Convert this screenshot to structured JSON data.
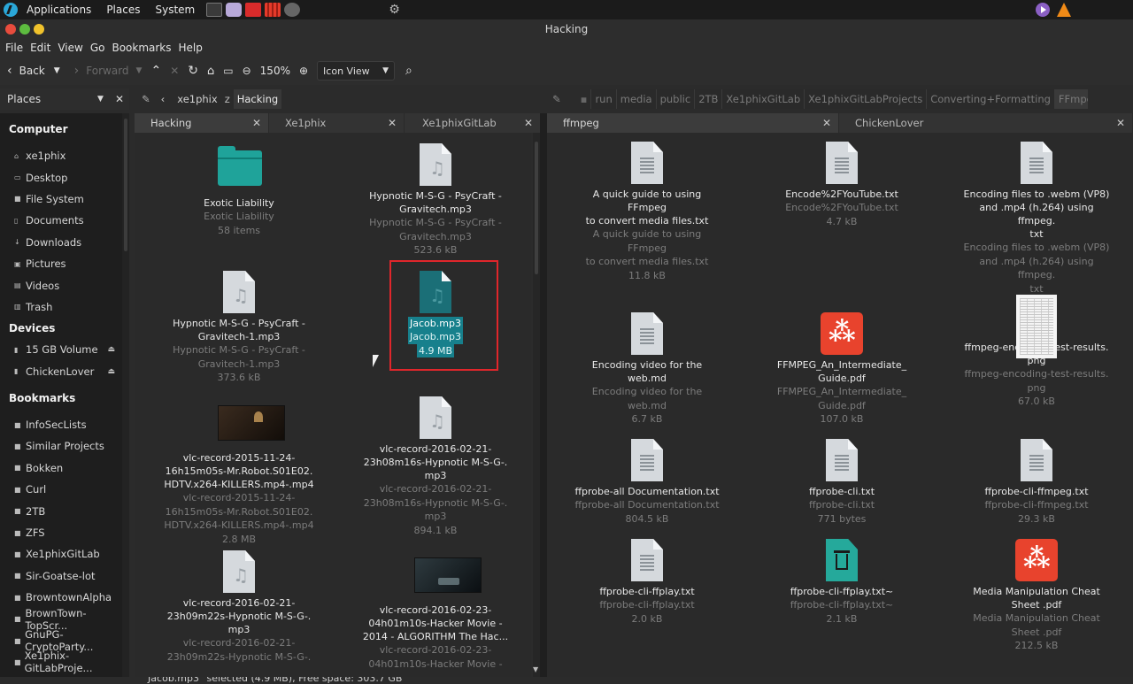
{
  "top_panel": {
    "menus": [
      "Applications",
      "Places",
      "System"
    ]
  },
  "window": {
    "title": "Hacking"
  },
  "menubar": [
    "File",
    "Edit",
    "View",
    "Go",
    "Bookmarks",
    "Help"
  ],
  "toolbar": {
    "back": "Back",
    "forward": "Forward",
    "zoom": "150%",
    "view_mode": "Icon View"
  },
  "sidebar": {
    "header": "Places",
    "sections": [
      {
        "title": "Computer",
        "items": [
          "xe1phix",
          "Desktop",
          "File System",
          "Documents",
          "Downloads",
          "Pictures",
          "Videos",
          "Trash"
        ]
      },
      {
        "title": "Devices",
        "items": [
          "15 GB Volume",
          "ChickenLover"
        ]
      },
      {
        "title": "Bookmarks",
        "items": [
          "InfoSecLists",
          "Similar Projects",
          "Bokken",
          "Curl",
          "2TB",
          "ZFS",
          "Xe1phixGitLab",
          "Sir-Goatse-lot",
          "BrowntownAlpha",
          "BrownTown-TopScr...",
          "GnuPG-CryptoParty...",
          "Xe1phix-GitLabProje..."
        ]
      }
    ]
  },
  "left_pane": {
    "path": [
      "xe1phix",
      "Hacking"
    ],
    "tabs": [
      "Hacking",
      "Xe1phix",
      "Xe1phixGitLab"
    ],
    "items": [
      {
        "name": [
          "Exotic Liability"
        ],
        "sub": [
          "Exotic Liability",
          "58 items"
        ],
        "icon": "folder"
      },
      {
        "name": [
          "Hypnotic M-S-G - PsyCraft -",
          "Gravitech.mp3"
        ],
        "sub": [
          "Hypnotic M-S-G - PsyCraft -",
          "Gravitech.mp3",
          "523.6 kB"
        ],
        "icon": "audio"
      },
      {
        "name": [
          "Hypnotic M-S-G - PsyCraft -",
          "Gravitech-1.mp3"
        ],
        "sub": [
          "Hypnotic M-S-G - PsyCraft -",
          "Gravitech-1.mp3",
          "373.6 kB"
        ],
        "icon": "audio"
      },
      {
        "name": [
          "Jacob.mp3"
        ],
        "sub": [
          "Jacob.mp3",
          "4.9 MB"
        ],
        "icon": "audio",
        "selected": true
      },
      {
        "name": [
          "vlc-record-2015-11-24-",
          "16h15m05s-Mr.Robot.S01E02.",
          "HDTV.x264-KILLERS.mp4-.mp4"
        ],
        "sub": [
          "vlc-record-2015-11-24-",
          "16h15m05s-Mr.Robot.S01E02.",
          "HDTV.x264-KILLERS.mp4-.mp4",
          "2.8 MB"
        ],
        "icon": "video-a"
      },
      {
        "name": [
          "vlc-record-2016-02-21-",
          "23h08m16s-Hypnotic M-S-G-.",
          "mp3"
        ],
        "sub": [
          "vlc-record-2016-02-21-",
          "23h08m16s-Hypnotic M-S-G-.",
          "mp3",
          "894.1 kB"
        ],
        "icon": "audio"
      },
      {
        "name": [
          "vlc-record-2016-02-21-",
          "23h09m22s-Hypnotic M-S-G-.",
          "mp3"
        ],
        "sub": [
          "vlc-record-2016-02-21-",
          "23h09m22s-Hypnotic M-S-G-."
        ],
        "icon": "audio"
      },
      {
        "name": [
          "vlc-record-2016-02-23-",
          "04h01m10s-Hacker Movie -",
          "2014 - ALGORITHM  The Hac..."
        ],
        "sub": [
          "vlc-record-2016-02-23-",
          "04h01m10s-Hacker Movie -"
        ],
        "icon": "video-b"
      }
    ]
  },
  "right_pane": {
    "path": [
      "run",
      "media",
      "public",
      "2TB",
      "Xe1phixGitLab",
      "Xe1phixGitLabProjects",
      "Converting+Formatting",
      "FFmpeg"
    ],
    "tabs": [
      "ffmpeg",
      "ChickenLover"
    ],
    "items": [
      {
        "name": [
          "A quick guide to using FFmpeg",
          "to convert media files.txt"
        ],
        "sub": [
          "A quick guide to using FFmpeg",
          "to convert media files.txt",
          "11.8 kB"
        ],
        "icon": "text"
      },
      {
        "name": [
          "Encode%2FYouTube.txt"
        ],
        "sub": [
          "Encode%2FYouTube.txt",
          "4.7 kB"
        ],
        "icon": "text"
      },
      {
        "name": [
          "Encoding files to .webm (VP8)",
          "and .mp4 (h.264) using ffmpeg.",
          "txt"
        ],
        "sub": [
          "Encoding files to .webm (VP8)",
          "and .mp4 (h.264) using ffmpeg.",
          "txt",
          "2.1 kB"
        ],
        "icon": "text"
      },
      {
        "name": [
          "Encoding video for the web.md"
        ],
        "sub": [
          "Encoding video for the web.md",
          "6.7 kB"
        ],
        "icon": "text"
      },
      {
        "name": [
          "FFMPEG_An_Intermediate_",
          "Guide.pdf"
        ],
        "sub": [
          "FFMPEG_An_Intermediate_",
          "Guide.pdf",
          "107.0 kB"
        ],
        "icon": "pdf"
      },
      {
        "name": [
          "ffmpeg-encoding-test-results.",
          "png"
        ],
        "sub": [
          "ffmpeg-encoding-test-results.",
          "png",
          "67.0 kB"
        ],
        "icon": "sheet"
      },
      {
        "name": [
          "ffprobe-all Documentation.txt"
        ],
        "sub": [
          "ffprobe-all Documentation.txt",
          "804.5 kB"
        ],
        "icon": "text"
      },
      {
        "name": [
          "ffprobe-cli.txt"
        ],
        "sub": [
          "ffprobe-cli.txt",
          "771 bytes"
        ],
        "icon": "text"
      },
      {
        "name": [
          "ffprobe-cli-ffmpeg.txt"
        ],
        "sub": [
          "ffprobe-cli-ffmpeg.txt",
          "29.3 kB"
        ],
        "icon": "text"
      },
      {
        "name": [
          "ffprobe-cli-ffplay.txt"
        ],
        "sub": [
          "ffprobe-cli-ffplay.txt",
          "2.0 kB"
        ],
        "icon": "text"
      },
      {
        "name": [
          "ffprobe-cli-ffplay.txt~"
        ],
        "sub": [
          "ffprobe-cli-ffplay.txt~",
          "2.1 kB"
        ],
        "icon": "trash"
      },
      {
        "name": [
          "Media Manipulation Cheat",
          "Sheet .pdf"
        ],
        "sub": [
          "Media Manipulation Cheat",
          "Sheet .pdf",
          "212.5 kB"
        ],
        "icon": "pdf"
      }
    ]
  },
  "status": "\"Jacob.mp3\" selected (4.9 MB), Free space: 303.7 GB",
  "colors": {
    "selection": "#17808c",
    "folder": "#1fa39a",
    "pdf": "#e8432d",
    "highlight_box": "#e0262b"
  }
}
